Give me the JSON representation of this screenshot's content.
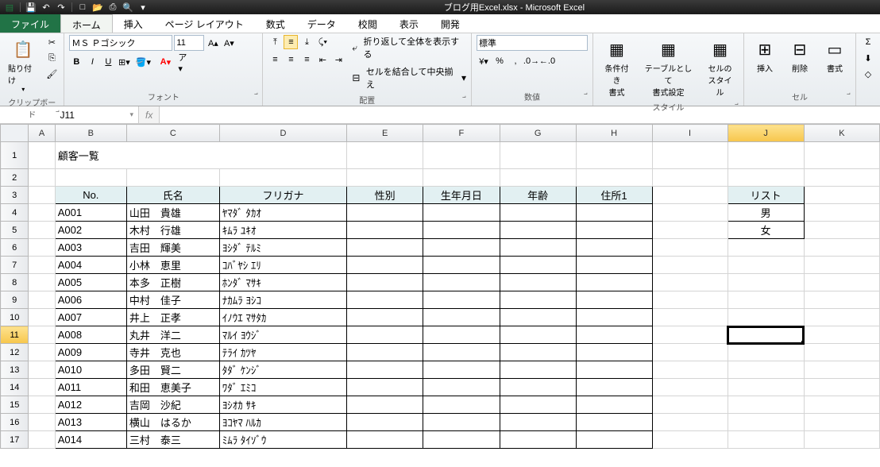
{
  "titlebar": {
    "title": "ブログ用Excel.xlsx - Microsoft Excel"
  },
  "tabs": {
    "file": "ファイル",
    "home": "ホーム",
    "insert": "挿入",
    "layout": "ページ レイアウト",
    "formula": "数式",
    "data": "データ",
    "review": "校閲",
    "view": "表示",
    "dev": "開発"
  },
  "ribbon": {
    "clipboard": {
      "paste": "貼り付け",
      "label": "クリップボード"
    },
    "font": {
      "name": "ＭＳ Ｐゴシック",
      "size": "11",
      "label": "フォント"
    },
    "align": {
      "wrap": "折り返して全体を表示する",
      "merge": "セルを結合して中央揃え",
      "label": "配置"
    },
    "number": {
      "format": "標準",
      "label": "数値"
    },
    "style": {
      "cond": "条件付き\n書式",
      "table": "テーブルとして\n書式設定",
      "cell": "セルの\nスタイル",
      "label": "スタイル"
    },
    "cells": {
      "insert": "挿入",
      "delete": "削除",
      "format": "書式",
      "label": "セル"
    }
  },
  "fxbar": {
    "namebox": "J11",
    "fx": "fx",
    "formula": ""
  },
  "columns": [
    "A",
    "B",
    "C",
    "D",
    "E",
    "F",
    "G",
    "H",
    "I",
    "J",
    "K"
  ],
  "sheet": {
    "title": "顧客一覧",
    "headers": {
      "no": "No.",
      "name": "氏名",
      "kana": "フリガナ",
      "sex": "性別",
      "birth": "生年月日",
      "age": "年齢",
      "addr": "住所1"
    },
    "list": {
      "hdr": "リスト",
      "items": [
        "男",
        "女"
      ]
    },
    "rows": [
      {
        "no": "A001",
        "name": "山田　貴雄",
        "kana": "ﾔﾏﾀﾞ ﾀｶｵ"
      },
      {
        "no": "A002",
        "name": "木村　行雄",
        "kana": "ｷﾑﾗ ﾕｷｵ"
      },
      {
        "no": "A003",
        "name": "吉田　輝美",
        "kana": "ﾖｼﾀﾞ ﾃﾙﾐ"
      },
      {
        "no": "A004",
        "name": "小林　恵里",
        "kana": "ｺﾊﾞﾔｼ ｴﾘ"
      },
      {
        "no": "A005",
        "name": "本多　正樹",
        "kana": "ﾎﾝﾀﾞ ﾏｻｷ"
      },
      {
        "no": "A006",
        "name": "中村　佳子",
        "kana": "ﾅｶﾑﾗ ﾖｼｺ"
      },
      {
        "no": "A007",
        "name": "井上　正孝",
        "kana": "ｲﾉｳｴ ﾏｻﾀｶ"
      },
      {
        "no": "A008",
        "name": "丸井　洋二",
        "kana": "ﾏﾙｲ ﾖｳｼﾞ"
      },
      {
        "no": "A009",
        "name": "寺井　克也",
        "kana": "ﾃﾗｲ ｶﾂﾔ"
      },
      {
        "no": "A010",
        "name": "多田　賢二",
        "kana": "ﾀﾀﾞ ｹﾝｼﾞ"
      },
      {
        "no": "A011",
        "name": "和田　恵美子",
        "kana": "ﾜﾀﾞ ｴﾐｺ"
      },
      {
        "no": "A012",
        "name": "吉岡　沙紀",
        "kana": "ﾖｼｵｶ ｻｷ"
      },
      {
        "no": "A013",
        "name": "横山　はるか",
        "kana": "ﾖｺﾔﾏ ﾊﾙｶ"
      },
      {
        "no": "A014",
        "name": "三村　泰三",
        "kana": "ﾐﾑﾗ ﾀｲｿﾞｳ"
      }
    ]
  }
}
